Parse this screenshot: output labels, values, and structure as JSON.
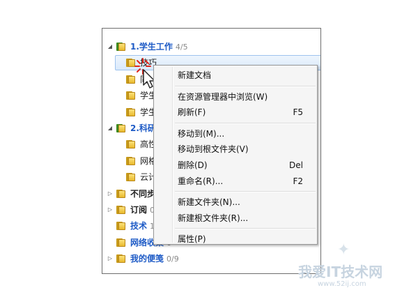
{
  "tree": {
    "items": [
      {
        "label": "1.学生工作",
        "count": "4/5",
        "style": "blue",
        "arrow": "expanded"
      },
      {
        "label": "技巧",
        "count": "",
        "style": "normal",
        "arrow": "none"
      },
      {
        "label": "同",
        "count": "",
        "style": "normal",
        "arrow": "none"
      },
      {
        "label": "学生",
        "count": "",
        "style": "normal",
        "arrow": "none"
      },
      {
        "label": "学生",
        "count": "",
        "style": "normal",
        "arrow": "none"
      },
      {
        "label": "2.科研",
        "count": "",
        "style": "blue",
        "arrow": "expanded"
      },
      {
        "label": "高性",
        "count": "",
        "style": "normal",
        "arrow": "none"
      },
      {
        "label": "网格",
        "count": "",
        "style": "normal",
        "arrow": "none"
      },
      {
        "label": "云计",
        "count": "",
        "style": "normal",
        "arrow": "none"
      },
      {
        "label": "不同步",
        "count": "",
        "style": "bold",
        "arrow": "collapsed"
      },
      {
        "label": "订阅",
        "count": "0",
        "style": "bold",
        "arrow": "collapsed"
      },
      {
        "label": "技术",
        "count": "1",
        "style": "blue",
        "arrow": "none"
      },
      {
        "label": "网络收集",
        "count": "6",
        "style": "blue",
        "arrow": "none"
      },
      {
        "label": "我的便笺",
        "count": "0/9",
        "style": "blue",
        "arrow": "collapsed"
      }
    ]
  },
  "context_menu": {
    "groups": [
      [
        {
          "label": "新建文档",
          "shortcut": ""
        }
      ],
      [
        {
          "label": "在资源管理器中浏览(W)",
          "shortcut": ""
        },
        {
          "label": "刷新(F)",
          "shortcut": "F5"
        }
      ],
      [
        {
          "label": "移动到(M)...",
          "shortcut": ""
        },
        {
          "label": "移动到根文件夹(V)",
          "shortcut": ""
        },
        {
          "label": "删除(D)",
          "shortcut": "Del"
        },
        {
          "label": "重命名(R)...",
          "shortcut": "F2"
        }
      ],
      [
        {
          "label": "新建文件夹(N)...",
          "shortcut": ""
        },
        {
          "label": "新建根文件夹(R)...",
          "shortcut": ""
        }
      ],
      [
        {
          "label": "属性(P)",
          "shortcut": ""
        }
      ]
    ]
  },
  "watermark": {
    "text": "我爱IT技术网",
    "sub": "www.52ij.com"
  },
  "colors": {
    "accent_blue": "#1e5bc6",
    "folder_yellow": "#f2c94c",
    "selection": "#dbe9fb"
  }
}
